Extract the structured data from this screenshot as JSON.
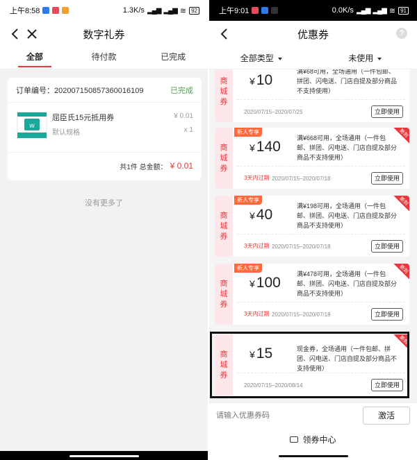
{
  "left": {
    "status": {
      "time": "上午8:58",
      "net": "1.3K/s",
      "battery": "92"
    },
    "nav": {
      "title": "数字礼券"
    },
    "tabs": [
      "全部",
      "待付款",
      "已完成"
    ],
    "order": {
      "number_label": "订单编号：20200715085736001610​9",
      "status": "已完成",
      "product_name": "屈臣氏15元抵用券",
      "spec": "默认规格",
      "price": "¥ 0.01",
      "qty": "x 1",
      "thumb_text": "¥15 屈臣氏抵用券",
      "total_label": "共1件 总金额：",
      "total_amount": "¥ 0.01"
    },
    "no_more": "没有更多了"
  },
  "right": {
    "status": {
      "time": "上午9:01",
      "net": "0.0K/s",
      "battery": "91"
    },
    "nav": {
      "title": "优惠券",
      "help": "?"
    },
    "filters": [
      "全部类型",
      "未使用"
    ],
    "side_text": [
      "商",
      "城",
      "券"
    ],
    "use_label": "立即使用",
    "new_badge": "新人专享",
    "corner_label": "新到",
    "coupons": [
      {
        "yen": "¥",
        "amount": "10",
        "cond": "满¥68可用，全场通用（一件包邮、拼团、闪电送、门店自提及部分商品不支持使用）",
        "warn": "",
        "date": "2020/07/15–2020/07/25"
      },
      {
        "yen": "¥",
        "amount": "140",
        "cond": "满¥668可用，全场通用（一件包邮、拼团、闪电送、门店自提及部分商品不支持使用）",
        "warn": "3天内过期",
        "date": "2020/07/15–2020/07/18"
      },
      {
        "yen": "¥",
        "amount": "40",
        "cond": "满¥198可用，全场通用（一件包邮、拼团、闪电送、门店自提及部分商品不支持使用）",
        "warn": "3天内过期",
        "date": "2020/07/15–2020/07/18"
      },
      {
        "yen": "¥",
        "amount": "100",
        "cond": "满¥478可用，全场通用（一件包邮、拼团、闪电送、门店自提及部分商品不支持使用）",
        "warn": "3天内过期",
        "date": "2020/07/15–2020/07/18"
      },
      {
        "yen": "¥",
        "amount": "15",
        "cond": "现金券，全场通用（一件包邮、拼团、闪电送、门店自提及部分商品不支持使用）",
        "warn": "",
        "date": "2020/07/15–2020/08/14"
      }
    ],
    "code_placeholder": "请输入优惠券码",
    "activate_label": "激活",
    "center_label": "领券中心"
  },
  "colors": {
    "accent": "#e8383d",
    "done": "#4aa84b",
    "badge": "#ff6a3d",
    "side": "#fde7ea"
  }
}
